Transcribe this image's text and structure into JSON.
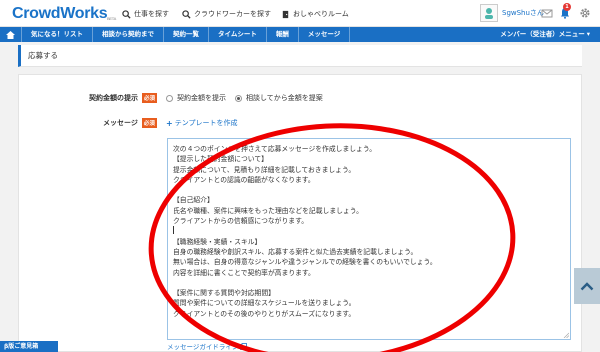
{
  "header": {
    "logo": "CrowdWorks",
    "logo_beta": "BETA",
    "links": [
      {
        "label": "仕事を探す",
        "icon": "search-icon"
      },
      {
        "label": "クラウドワーカーを探す",
        "icon": "search-icon"
      },
      {
        "label": "おしゃべりルーム",
        "icon": "door-icon"
      }
    ],
    "user_name": "SgwShuさん",
    "notification_count": "1"
  },
  "nav": {
    "items": [
      "気になる！リスト",
      "相談から契約まで",
      "契約一覧",
      "タイムシート",
      "報酬",
      "メッセージ"
    ],
    "right_label": "メンバー（受注者）メニュー",
    "right_caret": "▾"
  },
  "section_title": "応募する",
  "form": {
    "price_label": "契約金額の提示",
    "required_label": "必須",
    "price_options": [
      {
        "label": "契約金額を提示",
        "selected": false
      },
      {
        "label": "相談してから金額を提案",
        "selected": true
      }
    ],
    "message_label": "メッセージ",
    "template_link": "テンプレートを作成",
    "message_lines": [
      "次の４つのポイントを押さえて応募メッセージを作成しましょう。",
      "【提示した契約金額について】",
      "提示金額について、見積もり詳細を記載しておきましょう。",
      "クライアントとの認識の齟齬がなくなります。",
      "",
      "【自己紹介】",
      "氏名や職種、案件に興味をもった理由などを記載しましょう。",
      "クライアントからの信頼感につながります。",
      "",
      "【職務経験・実績・スキル】",
      "自身の職務経験や創訳スキル、応募する案件と似た過去実績を記載しましょう。",
      "無い場合は、自身の得意なジャンルや違うジャンルでの経験を書くのもいいでしょう。",
      "内容を詳細に書くことで契約率が高まります。",
      "",
      "【案件に関する質問や対応期間】",
      "質問や案件についての詳細なスケジュールを送りましょう。",
      "クライアントとのその後のやりとりがスムーズになります。"
    ],
    "guide_link": "メッセージガイドライン"
  },
  "feedback_label": "β版ご意見箱",
  "colors": {
    "brand_blue": "#1a6fc4",
    "required_orange": "#e85d1e",
    "annotation_red": "#ee0000"
  }
}
